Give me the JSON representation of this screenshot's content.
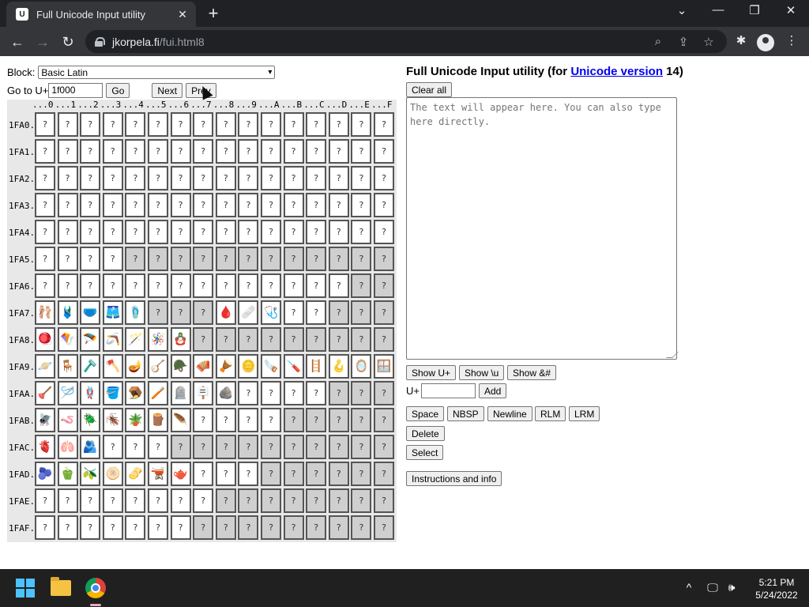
{
  "browser": {
    "tab_title": "Full Unicode Input utility",
    "favicon_letter": "U",
    "close_glyph": "✕",
    "new_tab_glyph": "+",
    "url_host": "jkorpela.fi",
    "url_path": "/fui.html8",
    "controls": {
      "minimize": "—",
      "restore": "❐",
      "close": "✕",
      "tab_list": "⌄"
    },
    "nav": {
      "back": "←",
      "forward": "→",
      "reload": "↻"
    },
    "icons": [
      "zoom-icon",
      "share-icon",
      "star-icon",
      "extensions-icon",
      "profile-icon",
      "menu-icon"
    ]
  },
  "left": {
    "block_label": "Block:",
    "block_value": "Basic Latin",
    "goto_label": "Go to U+",
    "goto_value": "1f000",
    "go_button": "Go",
    "next_button": "Next",
    "prev_button": "Prev"
  },
  "grid": {
    "col_headers": [
      "...0",
      "...1",
      "...2",
      "...3",
      "...4",
      "...5",
      "...6",
      "...7",
      "...8",
      "...9",
      "...A",
      "...B",
      "...C",
      "...D",
      "...E",
      "...F"
    ],
    "row_headers": [
      "1FA0.",
      "1FA1.",
      "1FA2.",
      "1FA3.",
      "1FA4.",
      "1FA5.",
      "1FA6.",
      "1FA7.",
      "1FA8.",
      "1FA9.",
      "1FAA.",
      "1FAB.",
      "1FAC.",
      "1FAD.",
      "1FAE.",
      "1FAF."
    ],
    "placeholder_glyph": "?",
    "cells": [
      [
        "?",
        "?",
        "?",
        "?",
        "?",
        "?",
        "?",
        "?",
        "?",
        "?",
        "?",
        "?",
        "?",
        "?",
        "?",
        "?"
      ],
      [
        "?",
        "?",
        "?",
        "?",
        "?",
        "?",
        "?",
        "?",
        "?",
        "?",
        "?",
        "?",
        "?",
        "?",
        "?",
        "?"
      ],
      [
        "?",
        "?",
        "?",
        "?",
        "?",
        "?",
        "?",
        "?",
        "?",
        "?",
        "?",
        "?",
        "?",
        "?",
        "?",
        "?"
      ],
      [
        "?",
        "?",
        "?",
        "?",
        "?",
        "?",
        "?",
        "?",
        "?",
        "?",
        "?",
        "?",
        "?",
        "?",
        "?",
        "?"
      ],
      [
        "?",
        "?",
        "?",
        "?",
        "?",
        "?",
        "?",
        "?",
        "?",
        "?",
        "?",
        "?",
        "?",
        "?",
        "?",
        "?"
      ],
      [
        "?",
        "?",
        "?",
        "?",
        "?#",
        "?#",
        "?#",
        "?#",
        "?#",
        "?#",
        "?#",
        "?#",
        "?#",
        "?#",
        "?#",
        "?#"
      ],
      [
        "?",
        "?",
        "?",
        "?",
        "?",
        "?",
        "?",
        "?",
        "?",
        "?",
        "?",
        "?",
        "?",
        "?",
        "?#",
        "?#"
      ],
      [
        "🩰",
        "🩱",
        "🩲",
        "🩳",
        "🩴",
        "?#",
        "?#",
        "?#",
        "🩸",
        "🩹",
        "🩺",
        "?",
        "?",
        "?#",
        "?#",
        "?#"
      ],
      [
        "🪀",
        "🪁",
        "🪂",
        "🪃",
        "🪄",
        "🪅",
        "🪆",
        "?#",
        "?#",
        "?#",
        "?#",
        "?#",
        "?#",
        "?#",
        "?#",
        "?#"
      ],
      [
        "🪐",
        "🪑",
        "🪒",
        "🪓",
        "🪔",
        "🪕",
        "🪖",
        "🪗",
        "🪘",
        "🪙",
        "🪚",
        "🪛",
        "🪜",
        "🪝",
        "🪞",
        "🪟"
      ],
      [
        "🪠",
        "🪡",
        "🪢",
        "🪣",
        "🪤",
        "🪥",
        "🪦",
        "🪧",
        "🪨",
        "?",
        "?",
        "?",
        "?",
        "?#",
        "?#",
        "?#"
      ],
      [
        "🪰",
        "🪱",
        "🪲",
        "🪳",
        "🪴",
        "🪵",
        "🪶",
        "?",
        "?",
        "?",
        "?",
        "?#",
        "?#",
        "?#",
        "?#",
        "?#"
      ],
      [
        "🫀",
        "🫁",
        "🫂",
        "?",
        "?",
        "?",
        "?#",
        "?#",
        "?#",
        "?#",
        "?#",
        "?#",
        "?#",
        "?#",
        "?#",
        "?#"
      ],
      [
        "🫐",
        "🫑",
        "🫒",
        "🫓",
        "🫔",
        "🫕",
        "🫖",
        "?",
        "?",
        "?",
        "?#",
        "?#",
        "?#",
        "?#",
        "?#",
        "?#"
      ],
      [
        "?",
        "?",
        "?",
        "?",
        "?",
        "?",
        "?",
        "?",
        "?#",
        "?#",
        "?#",
        "?#",
        "?#",
        "?#",
        "?#",
        "?#"
      ],
      [
        "?",
        "?",
        "?",
        "?",
        "?",
        "?",
        "?",
        "?#",
        "?#",
        "?#",
        "?#",
        "?#",
        "?#",
        "?#",
        "?#",
        "?#"
      ]
    ]
  },
  "right": {
    "title_prefix": "Full Unicode Input utility (for ",
    "title_link": "Unicode version",
    "title_suffix": " 14)",
    "clear_button": "Clear all",
    "textarea_placeholder": "The text will appear here. You can also type here directly.",
    "show_u": "Show U+",
    "show_backslash_u": "Show \\u",
    "show_entity": "Show &#",
    "u_label": "U+",
    "add_button": "Add",
    "space_button": "Space",
    "nbsp_button": "NBSP",
    "newline_button": "Newline",
    "rlm_button": "RLM",
    "lrm_button": "LRM",
    "delete_button": "Delete",
    "select_button": "Select",
    "instructions_button": "Instructions and info"
  },
  "taskbar": {
    "time": "5:21 PM",
    "date": "5/24/2022",
    "tray": {
      "chevron": "^",
      "network": "🖵",
      "volume": "🕪"
    }
  }
}
